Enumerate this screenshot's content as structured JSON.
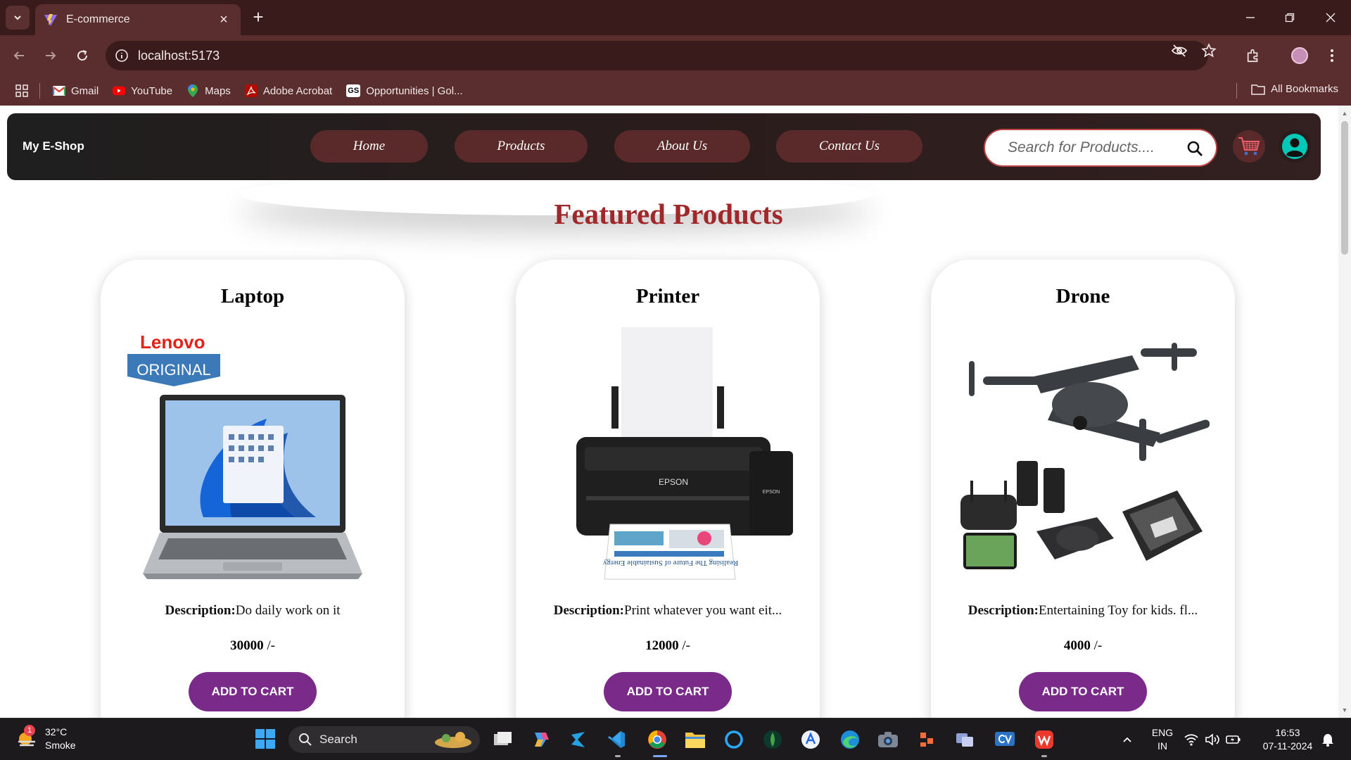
{
  "browser": {
    "tab_title": "E-commerce",
    "url": "localhost:5173",
    "bookmarks": [
      {
        "label": "Gmail",
        "icon": "gmail-icon"
      },
      {
        "label": "YouTube",
        "icon": "youtube-icon"
      },
      {
        "label": "Maps",
        "icon": "maps-icon"
      },
      {
        "label": "Adobe Acrobat",
        "icon": "acrobat-icon"
      },
      {
        "label": "Opportunities | Gol...",
        "icon": "gs-icon"
      }
    ],
    "all_bookmarks": "All Bookmarks"
  },
  "site": {
    "brand": "My E-Shop",
    "nav": [
      "Home",
      "Products",
      "About Us",
      "Contact Us"
    ],
    "search_placeholder": "Search for Products....",
    "section_title": "Featured Products"
  },
  "products": [
    {
      "name": "Laptop",
      "desc_label": "Description:",
      "desc": "Do daily work on it",
      "price": "30000",
      "price_suffix": " /-",
      "button": "ADD TO CART"
    },
    {
      "name": "Printer",
      "desc_label": "Description:",
      "desc": "Print whatever you want eit...",
      "price": "12000",
      "price_suffix": " /-",
      "button": "ADD TO CART"
    },
    {
      "name": "Drone",
      "desc_label": "Description:",
      "desc": "Entertaining Toy for kids. fl...",
      "price": "4000",
      "price_suffix": " /-",
      "button": "ADD TO CART"
    }
  ],
  "product_images": {
    "laptop_brand": "Lenovo",
    "laptop_badge": "ORIGINAL",
    "printer_brand": "EPSON",
    "printer_tank_brand": "EPSON",
    "printer_paper_text": "Realising The Future of Sustainable Energy"
  },
  "taskbar": {
    "weather_temp": "32°C",
    "weather_desc": "Smoke",
    "weather_badge": "1",
    "search_label": "Search",
    "lang_top": "ENG",
    "lang_bottom": "IN",
    "time": "16:53",
    "date": "07-11-2024"
  },
  "colors": {
    "accent": "#a0282b",
    "button": "#7a2b8a",
    "chrome": "#5a2e2e",
    "nav_pill": "#5a2a2a"
  }
}
